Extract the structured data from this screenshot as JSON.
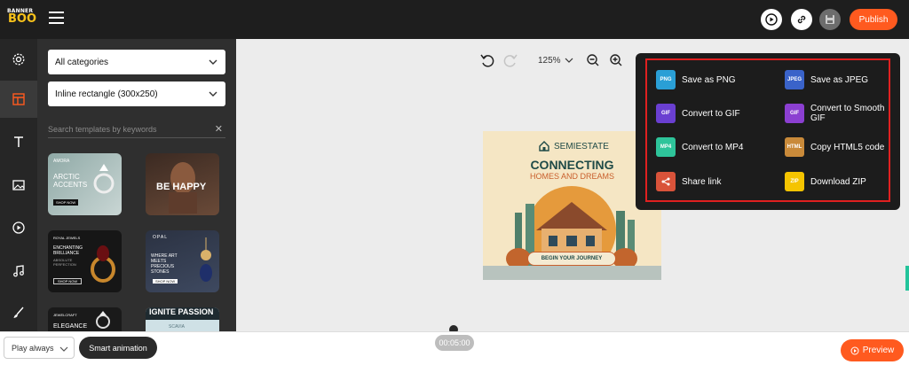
{
  "app": {
    "logo_line1": "BANNER",
    "logo_line2": "BOO",
    "publish_label": "Publish"
  },
  "rail": {
    "items": [
      "settings-icon",
      "templates-icon",
      "text-icon",
      "image-icon",
      "video-icon",
      "music-icon",
      "brush-icon"
    ],
    "active_index": 1
  },
  "panel": {
    "category_value": "All categories",
    "size_value": "Inline rectangle (300x250)",
    "search_placeholder": "Search templates by keywords",
    "templates": [
      {
        "name": "Arctic Accents",
        "brand": "AMORA",
        "title": "ARCTIC ACCENTS",
        "cta": "SHOP NOW"
      },
      {
        "name": "Be Happy",
        "title": "BE HAPPY"
      },
      {
        "name": "Enchanting Brilliance",
        "brand": "ROYAL JEWELS",
        "title": "ENCHANTING BRILLIANCE",
        "subtitle": "ABSOLUTE PERFECTION",
        "cta": "SHOP NOW"
      },
      {
        "name": "Opal",
        "brand": "OPAL",
        "title": "WHERE ART MEETS PRECIOUS STONES",
        "cta": "SHOP NOW"
      },
      {
        "name": "Elegance",
        "brand": "JEWELCRAFT",
        "title": "ELEGANCE"
      },
      {
        "name": "Ignite Passion",
        "title": "IGNITE PASSION",
        "subtitle": "SCAVIA"
      }
    ]
  },
  "canvas": {
    "zoom": "125%",
    "ad": {
      "brand": "SEMIESTATE",
      "headline": "CONNECTING",
      "subheadline": "HOMES AND DREAMS",
      "cta": "BEGIN YOUR JOURNEY"
    }
  },
  "export_menu": {
    "items": [
      {
        "icon": "PNG",
        "label": "Save as PNG",
        "color": "#2a9fd6"
      },
      {
        "icon": "JPEG",
        "label": "Save as JPEG",
        "color": "#3a63c9"
      },
      {
        "icon": "GIF",
        "label": "Convert to GIF",
        "color": "#6a3fd1"
      },
      {
        "icon": "GIF",
        "label": "Convert to Smooth GIF",
        "color": "#8b3fd1"
      },
      {
        "icon": "MP4",
        "label": "Convert to MP4",
        "color": "#2ec49a"
      },
      {
        "icon": "HTML",
        "label": "Copy HTML5 code",
        "color": "#c98a3a"
      },
      {
        "icon": "share",
        "label": "Share link",
        "color": "#d9533a"
      },
      {
        "icon": "ZIP",
        "label": "Download ZIP",
        "color": "#f5c400"
      }
    ]
  },
  "bottom": {
    "play_mode": "Play always",
    "smart_label": "Smart animation",
    "timer": "00:05:00",
    "preview_label": "Preview"
  },
  "colors": {
    "accent": "#ff5a1f",
    "dark": "#1e1e1e",
    "highlight_border": "#e02020"
  }
}
